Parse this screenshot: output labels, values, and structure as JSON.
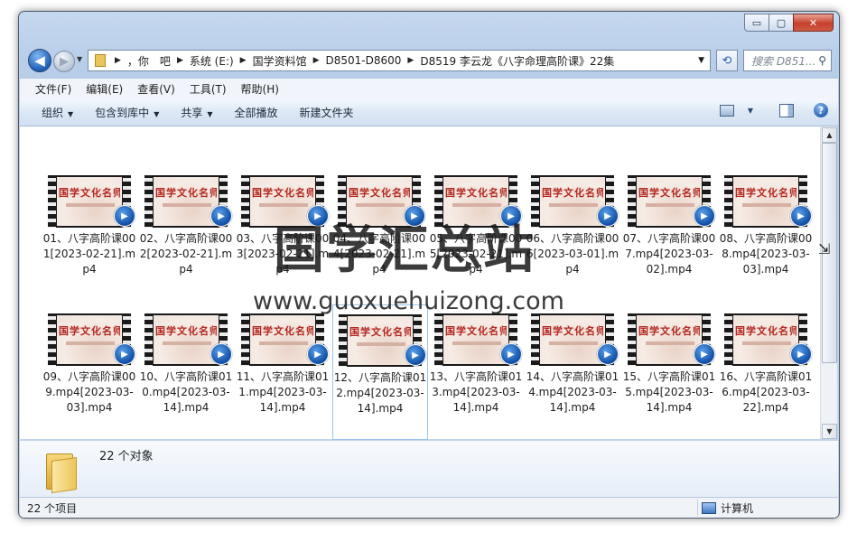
{
  "window": {
    "caption_buttons": {
      "minimize": "▭",
      "maximize": "▢",
      "close": "✕"
    }
  },
  "address": {
    "crumbs": [
      "，你　吧",
      "系统 (E:)",
      "国学资料馆",
      "D8501-D8600",
      "D8519 李云龙《八字命理高阶课》22集"
    ],
    "search_placeholder": "搜索 D851..."
  },
  "menu": [
    "文件(F)",
    "编辑(E)",
    "查看(V)",
    "工具(T)",
    "帮助(H)"
  ],
  "toolbar": {
    "organize": "组织",
    "include": "包含到库中",
    "share": "共享",
    "play_all": "全部播放",
    "new_folder": "新建文件夹"
  },
  "thumbnail_text": "国学文化名师系",
  "files": [
    {
      "name": "01、八字高阶课001[2023-02-21].mp4"
    },
    {
      "name": "02、八字高阶课002[2023-02-21].mp4"
    },
    {
      "name": "03、八字高阶课003[2023-02-21].mp4"
    },
    {
      "name": "04、八字高阶课004[2023-02-21].mp4"
    },
    {
      "name": "05、八字高阶课005[2023-02-21].mp4"
    },
    {
      "name": "06、八字高阶课006[2023-03-01].mp4"
    },
    {
      "name": "07、八字高阶课007.mp4[2023-03-02].mp4"
    },
    {
      "name": "08、八字高阶课008.mp4[2023-03-03].mp4"
    },
    {
      "name": "09、八字高阶课009.mp4[2023-03-03].mp4"
    },
    {
      "name": "10、八字高阶课010.mp4[2023-03-14].mp4"
    },
    {
      "name": "11、八字高阶课011.mp4[2023-03-14].mp4"
    },
    {
      "name": "12、八字高阶课012.mp4[2023-03-14].mp4"
    },
    {
      "name": "13、八字高阶课013.mp4[2023-03-14].mp4"
    },
    {
      "name": "14、八字高阶课014.mp4[2023-03-14].mp4"
    },
    {
      "name": "15、八字高阶课015.mp4[2023-03-14].mp4"
    },
    {
      "name": "16、八字高阶课016.mp4[2023-03-22].mp4"
    }
  ],
  "details": {
    "count": "22 个对象"
  },
  "status": {
    "items": "22 个项目",
    "location": "计算机"
  },
  "watermark": {
    "title": "国学汇总站",
    "url": "www.guoxuehuizong.com"
  }
}
